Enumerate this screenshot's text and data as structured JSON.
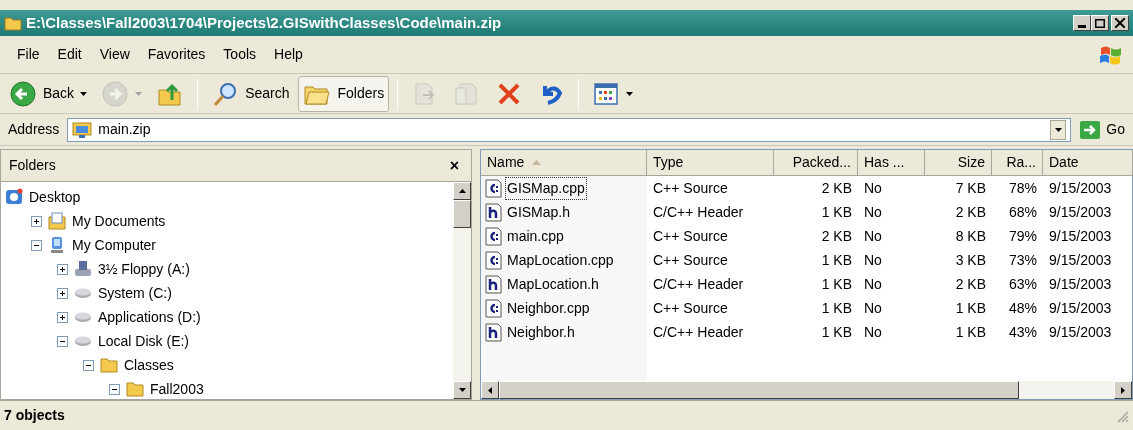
{
  "window": {
    "title": "E:\\Classes\\Fall2003\\1704\\Projects\\2.GISwithClasses\\Code\\main.zip"
  },
  "menu": [
    "File",
    "Edit",
    "View",
    "Favorites",
    "Tools",
    "Help"
  ],
  "toolbar": [
    {
      "kind": "back",
      "label": "Back",
      "dropdown": true,
      "disabled": false,
      "pressed": false
    },
    {
      "kind": "forward",
      "dropdown": true,
      "disabled": true,
      "pressed": false
    },
    {
      "kind": "up",
      "disabled": false,
      "pressed": false
    },
    {
      "kind": "separator"
    },
    {
      "kind": "search",
      "label": "Search",
      "disabled": false,
      "pressed": false
    },
    {
      "kind": "folders",
      "label": "Folders",
      "disabled": false,
      "pressed": true
    },
    {
      "kind": "separator"
    },
    {
      "kind": "move",
      "disabled": true,
      "pressed": false
    },
    {
      "kind": "copy",
      "disabled": true,
      "pressed": false
    },
    {
      "kind": "delete",
      "disabled": false,
      "pressed": false
    },
    {
      "kind": "undo",
      "disabled": false,
      "pressed": false
    },
    {
      "kind": "separator"
    },
    {
      "kind": "views",
      "dropdown": true,
      "disabled": false,
      "pressed": false
    }
  ],
  "address": {
    "label": "Address",
    "value": "main.zip",
    "go": "Go"
  },
  "folders_pane": {
    "title": "Folders",
    "close": "×",
    "tree": [
      {
        "label": "Desktop",
        "kind": "desktop",
        "children": [
          {
            "label": "My Documents",
            "kind": "documents",
            "expanded": false
          },
          {
            "label": "My Computer",
            "kind": "computer",
            "expanded": true,
            "children": [
              {
                "label": "3½ Floppy (A:)",
                "kind": "floppy",
                "expanded": false
              },
              {
                "label": "System (C:)",
                "kind": "drive",
                "expanded": false
              },
              {
                "label": "Applications (D:)",
                "kind": "drive",
                "expanded": false
              },
              {
                "label": "Local Disk (E:)",
                "kind": "drive",
                "expanded": true,
                "children": [
                  {
                    "label": "Classes",
                    "kind": "folder",
                    "expanded": true,
                    "children": [
                      {
                        "label": "Fall2003",
                        "kind": "folder",
                        "expanded": true
                      }
                    ]
                  }
                ]
              }
            ]
          }
        ]
      }
    ]
  },
  "files": {
    "columns": [
      {
        "label": "Name",
        "numeric": false,
        "sorted": true
      },
      {
        "label": "Type",
        "numeric": false,
        "sorted": false
      },
      {
        "label": "Packed...",
        "numeric": true,
        "sorted": false
      },
      {
        "label": "Has ...",
        "numeric": false,
        "sorted": false
      },
      {
        "label": "Size",
        "numeric": true,
        "sorted": false
      },
      {
        "label": "Ra...",
        "numeric": true,
        "sorted": false
      },
      {
        "label": "Date",
        "numeric": false,
        "sorted": false
      }
    ],
    "rows": [
      {
        "kind": "source",
        "focused": true,
        "cells": [
          "GISMap.cpp",
          "C++ Source",
          "2 KB",
          "No",
          "7 KB",
          "78%",
          "9/15/2003"
        ]
      },
      {
        "kind": "header",
        "focused": false,
        "cells": [
          "GISMap.h",
          "C/C++ Header",
          "1 KB",
          "No",
          "2 KB",
          "68%",
          "9/15/2003"
        ]
      },
      {
        "kind": "source",
        "focused": false,
        "cells": [
          "main.cpp",
          "C++ Source",
          "2 KB",
          "No",
          "8 KB",
          "79%",
          "9/15/2003"
        ]
      },
      {
        "kind": "source",
        "focused": false,
        "cells": [
          "MapLocation.cpp",
          "C++ Source",
          "1 KB",
          "No",
          "3 KB",
          "73%",
          "9/15/2003"
        ]
      },
      {
        "kind": "header",
        "focused": false,
        "cells": [
          "MapLocation.h",
          "C/C++ Header",
          "1 KB",
          "No",
          "2 KB",
          "63%",
          "9/15/2003"
        ]
      },
      {
        "kind": "source",
        "focused": false,
        "cells": [
          "Neighbor.cpp",
          "C++ Source",
          "1 KB",
          "No",
          "1 KB",
          "48%",
          "9/15/2003"
        ]
      },
      {
        "kind": "header",
        "focused": false,
        "cells": [
          "Neighbor.h",
          "C/C++ Header",
          "1 KB",
          "No",
          "1 KB",
          "43%",
          "9/15/2003"
        ]
      }
    ]
  },
  "status_bar": {
    "text": "7 objects"
  }
}
